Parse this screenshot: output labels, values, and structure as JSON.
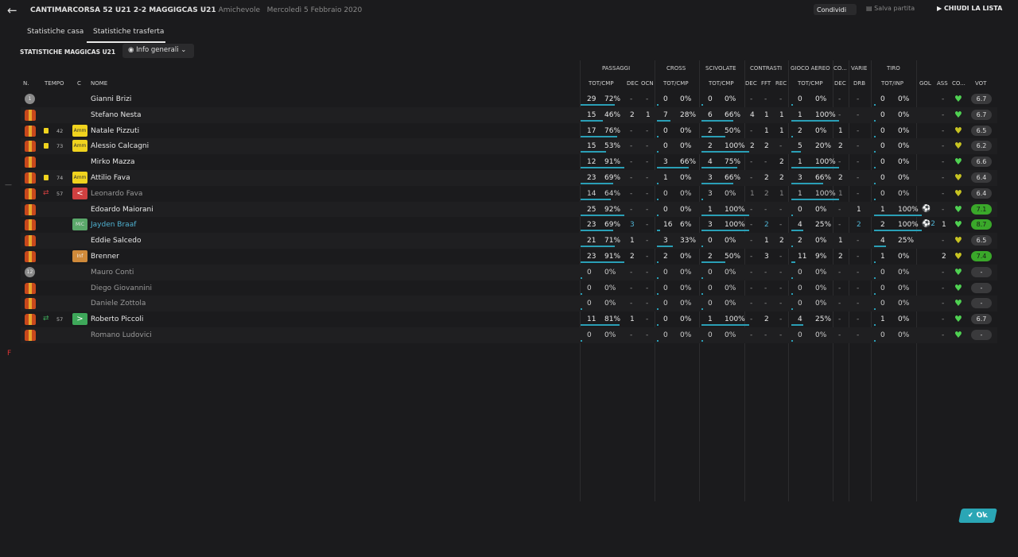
{
  "header": {
    "back_icon": "arrow-left-icon",
    "match_title": "CANTIMARCORSA 52 U21 2-2 MAGGIGCAS U21",
    "match_type": "Amichevole",
    "match_date": "Mercoledì 5 Febbraio 2020",
    "share_label": "Condividi",
    "save_label": "Salva partita",
    "close_label": "CHIUDI LA LISTA"
  },
  "tabs": [
    "Statistiche casa",
    "Statistiche trasferta"
  ],
  "active_tab": 1,
  "section_title": "STATISTICHE MAGGICAS U21",
  "dropdown": {
    "label": "Info generali",
    "icon": "eye-icon"
  },
  "column_groups": {
    "passaggi": "PASSAGGI",
    "cross": "CROSS",
    "scivolate": "SCIVOLATE",
    "contrasti": "CONTRASTI",
    "gioco_aereo": "GIOCO AEREO",
    "co": "CO...",
    "varie": "VARIE",
    "tiro": "TIRO"
  },
  "columns": {
    "n": "N.",
    "tempo": "TEMPO",
    "c": "C",
    "nome": "NOME",
    "tot_cmp": "TOT/CMP",
    "dec": "DEC",
    "ocn": "OCN",
    "fft": "FFT",
    "rec": "REC",
    "drb": "DRB",
    "tot_inp": "TOT/INP",
    "gol": "GOL",
    "ass": "ASS",
    "co": "CO...",
    "vot": "VOT"
  },
  "rows": [
    {
      "name": "Gianni Brizi",
      "gk": true,
      "gknum": "1",
      "pas": [
        "29",
        "72%"
      ],
      "pdec": "-",
      "pocn": "-",
      "cr": [
        "0",
        "0%"
      ],
      "sc": [
        "0",
        "0%"
      ],
      "cdec": "-",
      "fft": "-",
      "rec": "-",
      "ga": [
        "0",
        "0%"
      ],
      "gadec": "-",
      "drb": "-",
      "ti": [
        "0",
        "0%"
      ],
      "gol": "",
      "ass": "-",
      "vote": "6.7"
    },
    {
      "name": "Stefano Nesta",
      "pas": [
        "15",
        "46%"
      ],
      "pdec": "2",
      "pocn": "1",
      "cr": [
        "7",
        "28%"
      ],
      "sc": [
        "6",
        "66%"
      ],
      "cdec": "4",
      "fft": "1",
      "rec": "1",
      "ga": [
        "1",
        "100%"
      ],
      "gadec": "-",
      "drb": "-",
      "ti": [
        "0",
        "0%"
      ],
      "gol": "",
      "ass": "-",
      "vote": "6.7"
    },
    {
      "name": "Natale Pizzuti",
      "card": true,
      "min": "42",
      "badge": "Amm",
      "pas": [
        "17",
        "76%"
      ],
      "pdec": "-",
      "pocn": "-",
      "cr": [
        "0",
        "0%"
      ],
      "sc": [
        "2",
        "50%"
      ],
      "cdec": "-",
      "fft": "1",
      "rec": "1",
      "ga": [
        "2",
        "0%"
      ],
      "gadec": "1",
      "drb": "-",
      "ti": [
        "0",
        "0%"
      ],
      "gol": "",
      "ass": "-",
      "vote": "6.5"
    },
    {
      "name": "Alessio Calcagni",
      "card": true,
      "min": "73",
      "badge": "Amm",
      "pas": [
        "15",
        "53%"
      ],
      "pdec": "-",
      "pocn": "-",
      "cr": [
        "0",
        "0%"
      ],
      "sc": [
        "2",
        "100%"
      ],
      "cdec": "2",
      "fft": "2",
      "rec": "-",
      "ga": [
        "5",
        "20%"
      ],
      "gadec": "2",
      "drb": "-",
      "ti": [
        "0",
        "0%"
      ],
      "gol": "",
      "ass": "-",
      "vote": "6.2"
    },
    {
      "name": "Mirko Mazza",
      "pas": [
        "12",
        "91%"
      ],
      "pdec": "-",
      "pocn": "-",
      "cr": [
        "3",
        "66%"
      ],
      "sc": [
        "4",
        "75%"
      ],
      "cdec": "-",
      "fft": "-",
      "rec": "2",
      "ga": [
        "1",
        "100%"
      ],
      "gadec": "-",
      "drb": "-",
      "ti": [
        "0",
        "0%"
      ],
      "gol": "",
      "ass": "-",
      "vote": "6.6"
    },
    {
      "name": "Attilio Fava",
      "card": true,
      "min": "74",
      "badge": "Amm",
      "pas": [
        "23",
        "69%"
      ],
      "pdec": "-",
      "pocn": "-",
      "cr": [
        "1",
        "0%"
      ],
      "sc": [
        "3",
        "66%"
      ],
      "cdec": "-",
      "fft": "2",
      "rec": "2",
      "ga": [
        "3",
        "66%"
      ],
      "gadec": "2",
      "drb": "-",
      "ti": [
        "0",
        "0%"
      ],
      "gol": "",
      "ass": "-",
      "vote": "6.4"
    },
    {
      "name": "Leonardo Fava",
      "dim": true,
      "subout": true,
      "min": "57",
      "badge": "<",
      "pas": [
        "14",
        "64%"
      ],
      "pdec": "-",
      "pocn": "-",
      "cr": [
        "0",
        "0%"
      ],
      "sc": [
        "3",
        "0%"
      ],
      "cdec": "1",
      "fft": "2",
      "rec": "1",
      "ga": [
        "1",
        "100%"
      ],
      "gadec": "1",
      "drb": "-",
      "ti": [
        "0",
        "0%"
      ],
      "gol": "",
      "ass": "-",
      "vote": "6.4"
    },
    {
      "name": "Edoardo Maiorani",
      "pas": [
        "25",
        "92%"
      ],
      "pdec": "-",
      "pocn": "-",
      "cr": [
        "0",
        "0%"
      ],
      "sc": [
        "1",
        "100%"
      ],
      "cdec": "-",
      "fft": "-",
      "rec": "-",
      "ga": [
        "0",
        "0%"
      ],
      "gadec": "-",
      "drb": "1",
      "ti": [
        "1",
        "100%"
      ],
      "gol": "ball",
      "ass": "-",
      "vote": "7.1",
      "hi": true
    },
    {
      "name": "Jayden Braaf",
      "blue": true,
      "badge": "MiC",
      "pas": [
        "23",
        "69%"
      ],
      "pdec": "3",
      "pocn": "-",
      "cr": [
        "16",
        "6%"
      ],
      "sc": [
        "3",
        "100%"
      ],
      "cdec": "-",
      "fft": "2",
      "rec": "-",
      "ga": [
        "4",
        "25%"
      ],
      "gadec": "-",
      "drb": "2",
      "ti": [
        "2",
        "100%"
      ],
      "gol": "ball2",
      "ass": "1",
      "vote": "8.7",
      "hi": true
    },
    {
      "name": "Eddie Salcedo",
      "pas": [
        "21",
        "71%"
      ],
      "pdec": "1",
      "pocn": "-",
      "cr": [
        "3",
        "33%"
      ],
      "sc": [
        "0",
        "0%"
      ],
      "cdec": "-",
      "fft": "1",
      "rec": "2",
      "ga": [
        "2",
        "0%"
      ],
      "gadec": "1",
      "drb": "-",
      "ti": [
        "4",
        "25%"
      ],
      "gol": "",
      "ass": "-",
      "vote": "6.5"
    },
    {
      "name": "Brenner",
      "badge": "Inf",
      "pas": [
        "23",
        "91%"
      ],
      "pdec": "2",
      "pocn": "-",
      "cr": [
        "2",
        "0%"
      ],
      "sc": [
        "2",
        "50%"
      ],
      "cdec": "-",
      "fft": "3",
      "rec": "-",
      "ga": [
        "11",
        "9%"
      ],
      "gadec": "2",
      "drb": "-",
      "ti": [
        "1",
        "0%"
      ],
      "gol": "",
      "ass": "2",
      "vote": "7.4",
      "hi": true
    },
    {
      "name": "Mauro Conti",
      "dim": true,
      "gk": true,
      "gknum": "12",
      "pas": [
        "0",
        "0%"
      ],
      "pdec": "-",
      "pocn": "-",
      "cr": [
        "0",
        "0%"
      ],
      "sc": [
        "0",
        "0%"
      ],
      "cdec": "-",
      "fft": "-",
      "rec": "-",
      "ga": [
        "0",
        "0%"
      ],
      "gadec": "-",
      "drb": "-",
      "ti": [
        "0",
        "0%"
      ],
      "gol": "",
      "ass": "-",
      "vote": "-"
    },
    {
      "name": "Diego Giovannini",
      "dim": true,
      "pas": [
        "0",
        "0%"
      ],
      "pdec": "-",
      "pocn": "-",
      "cr": [
        "0",
        "0%"
      ],
      "sc": [
        "0",
        "0%"
      ],
      "cdec": "-",
      "fft": "-",
      "rec": "-",
      "ga": [
        "0",
        "0%"
      ],
      "gadec": "-",
      "drb": "-",
      "ti": [
        "0",
        "0%"
      ],
      "gol": "",
      "ass": "-",
      "vote": "-"
    },
    {
      "name": "Daniele Zottola",
      "dim": true,
      "pas": [
        "0",
        "0%"
      ],
      "pdec": "-",
      "pocn": "-",
      "cr": [
        "0",
        "0%"
      ],
      "sc": [
        "0",
        "0%"
      ],
      "cdec": "-",
      "fft": "-",
      "rec": "-",
      "ga": [
        "0",
        "0%"
      ],
      "gadec": "-",
      "drb": "-",
      "ti": [
        "0",
        "0%"
      ],
      "gol": "",
      "ass": "-",
      "vote": "-"
    },
    {
      "name": "Roberto Piccoli",
      "subin": true,
      "min": "57",
      "badge": ">",
      "pas": [
        "11",
        "81%"
      ],
      "pdec": "1",
      "pocn": "-",
      "cr": [
        "0",
        "0%"
      ],
      "sc": [
        "1",
        "100%"
      ],
      "cdec": "-",
      "fft": "2",
      "rec": "-",
      "ga": [
        "4",
        "25%"
      ],
      "gadec": "-",
      "drb": "-",
      "ti": [
        "1",
        "0%"
      ],
      "gol": "",
      "ass": "-",
      "vote": "6.7"
    },
    {
      "name": "Romano Ludovici",
      "dim": true,
      "pas": [
        "0",
        "0%"
      ],
      "pdec": "-",
      "pocn": "-",
      "cr": [
        "0",
        "0%"
      ],
      "sc": [
        "0",
        "0%"
      ],
      "cdec": "-",
      "fft": "-",
      "rec": "-",
      "ga": [
        "0",
        "0%"
      ],
      "gadec": "-",
      "drb": "-",
      "ti": [
        "0",
        "0%"
      ],
      "gol": "",
      "ass": "-",
      "vote": "-"
    }
  ],
  "ok_label": "Ok",
  "side_mark": "F",
  "side_dash": "—",
  "colors": {
    "accent": "#2aa6b5",
    "high_vote": "#3aa82a",
    "yellow_card": "#f0d31e",
    "sub_out": "#d04040",
    "sub_in": "#3ea85a",
    "dim_text": "#9a9a9a",
    "blue_name": "#4fb2d2"
  }
}
